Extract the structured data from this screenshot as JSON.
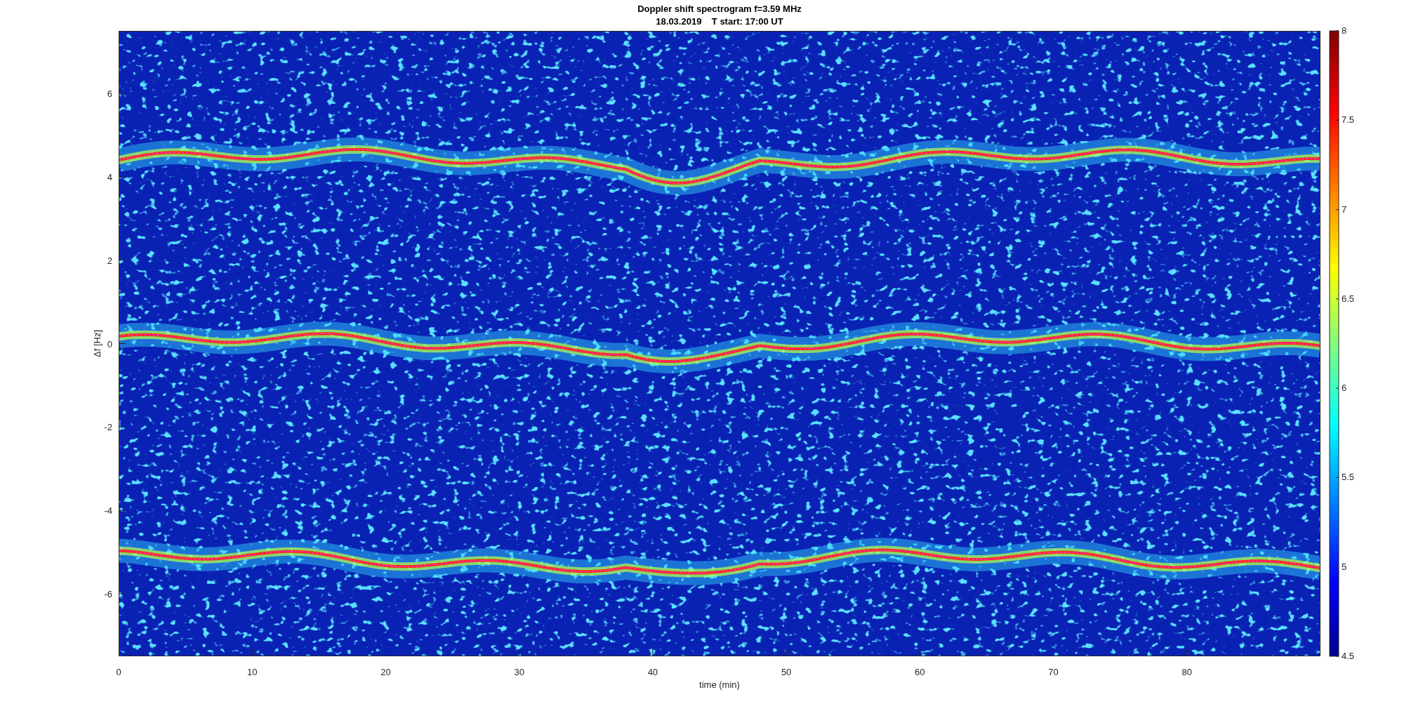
{
  "figure": {
    "title_lines": [
      "Doppler shift spectrogram f=3.59 MHz",
      "18.03.2019    T start: 17:00 UT"
    ],
    "xlabel": "time (min)",
    "ylabel": "Δf [Hz]",
    "xticks": [
      "0",
      "10",
      "20",
      "30",
      "40",
      "50",
      "60",
      "70",
      "80"
    ],
    "yticks": [
      "6",
      "4",
      "2",
      "0",
      "-2",
      "-4",
      "-6"
    ],
    "colorbar_ticks": [
      "8",
      "7.5",
      "7",
      "6.5",
      "6",
      "5.5",
      "5",
      "4.5"
    ]
  }
}
